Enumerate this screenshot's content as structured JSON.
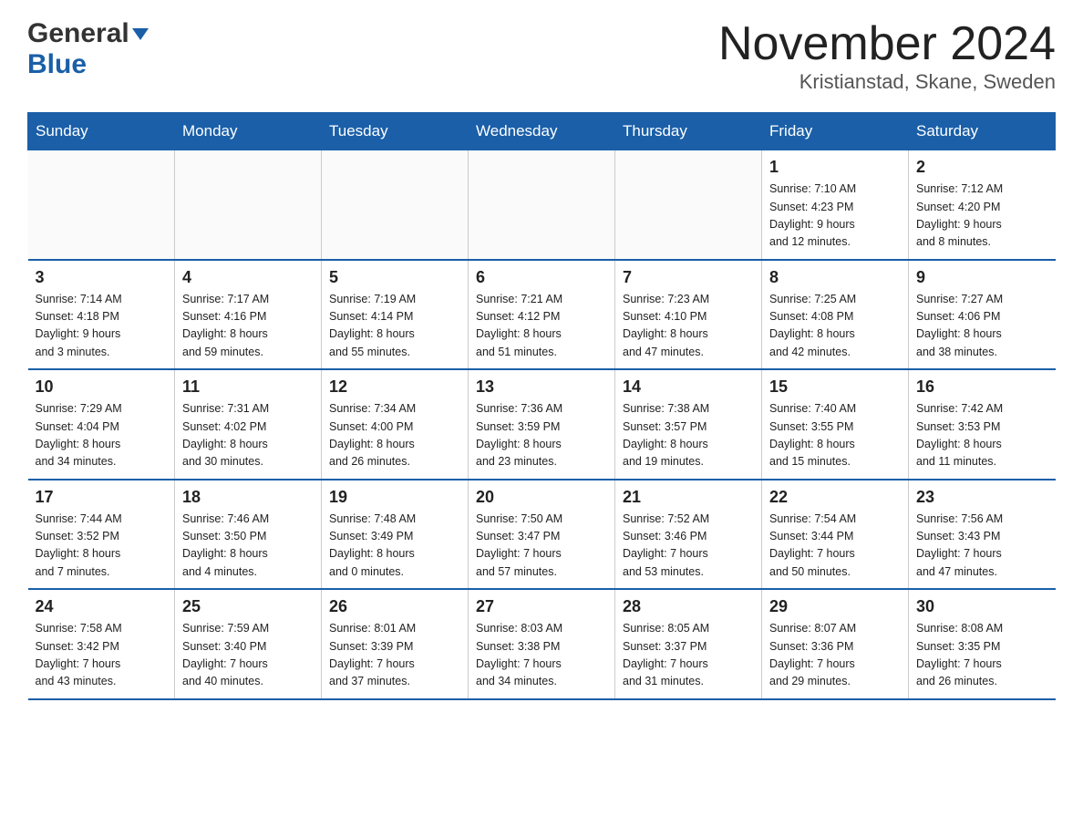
{
  "header": {
    "logo_general": "General",
    "logo_blue": "Blue",
    "month_title": "November 2024",
    "location": "Kristianstad, Skane, Sweden"
  },
  "weekdays": [
    "Sunday",
    "Monday",
    "Tuesday",
    "Wednesday",
    "Thursday",
    "Friday",
    "Saturday"
  ],
  "weeks": [
    [
      {
        "day": "",
        "info": ""
      },
      {
        "day": "",
        "info": ""
      },
      {
        "day": "",
        "info": ""
      },
      {
        "day": "",
        "info": ""
      },
      {
        "day": "",
        "info": ""
      },
      {
        "day": "1",
        "info": "Sunrise: 7:10 AM\nSunset: 4:23 PM\nDaylight: 9 hours\nand 12 minutes."
      },
      {
        "day": "2",
        "info": "Sunrise: 7:12 AM\nSunset: 4:20 PM\nDaylight: 9 hours\nand 8 minutes."
      }
    ],
    [
      {
        "day": "3",
        "info": "Sunrise: 7:14 AM\nSunset: 4:18 PM\nDaylight: 9 hours\nand 3 minutes."
      },
      {
        "day": "4",
        "info": "Sunrise: 7:17 AM\nSunset: 4:16 PM\nDaylight: 8 hours\nand 59 minutes."
      },
      {
        "day": "5",
        "info": "Sunrise: 7:19 AM\nSunset: 4:14 PM\nDaylight: 8 hours\nand 55 minutes."
      },
      {
        "day": "6",
        "info": "Sunrise: 7:21 AM\nSunset: 4:12 PM\nDaylight: 8 hours\nand 51 minutes."
      },
      {
        "day": "7",
        "info": "Sunrise: 7:23 AM\nSunset: 4:10 PM\nDaylight: 8 hours\nand 47 minutes."
      },
      {
        "day": "8",
        "info": "Sunrise: 7:25 AM\nSunset: 4:08 PM\nDaylight: 8 hours\nand 42 minutes."
      },
      {
        "day": "9",
        "info": "Sunrise: 7:27 AM\nSunset: 4:06 PM\nDaylight: 8 hours\nand 38 minutes."
      }
    ],
    [
      {
        "day": "10",
        "info": "Sunrise: 7:29 AM\nSunset: 4:04 PM\nDaylight: 8 hours\nand 34 minutes."
      },
      {
        "day": "11",
        "info": "Sunrise: 7:31 AM\nSunset: 4:02 PM\nDaylight: 8 hours\nand 30 minutes."
      },
      {
        "day": "12",
        "info": "Sunrise: 7:34 AM\nSunset: 4:00 PM\nDaylight: 8 hours\nand 26 minutes."
      },
      {
        "day": "13",
        "info": "Sunrise: 7:36 AM\nSunset: 3:59 PM\nDaylight: 8 hours\nand 23 minutes."
      },
      {
        "day": "14",
        "info": "Sunrise: 7:38 AM\nSunset: 3:57 PM\nDaylight: 8 hours\nand 19 minutes."
      },
      {
        "day": "15",
        "info": "Sunrise: 7:40 AM\nSunset: 3:55 PM\nDaylight: 8 hours\nand 15 minutes."
      },
      {
        "day": "16",
        "info": "Sunrise: 7:42 AM\nSunset: 3:53 PM\nDaylight: 8 hours\nand 11 minutes."
      }
    ],
    [
      {
        "day": "17",
        "info": "Sunrise: 7:44 AM\nSunset: 3:52 PM\nDaylight: 8 hours\nand 7 minutes."
      },
      {
        "day": "18",
        "info": "Sunrise: 7:46 AM\nSunset: 3:50 PM\nDaylight: 8 hours\nand 4 minutes."
      },
      {
        "day": "19",
        "info": "Sunrise: 7:48 AM\nSunset: 3:49 PM\nDaylight: 8 hours\nand 0 minutes."
      },
      {
        "day": "20",
        "info": "Sunrise: 7:50 AM\nSunset: 3:47 PM\nDaylight: 7 hours\nand 57 minutes."
      },
      {
        "day": "21",
        "info": "Sunrise: 7:52 AM\nSunset: 3:46 PM\nDaylight: 7 hours\nand 53 minutes."
      },
      {
        "day": "22",
        "info": "Sunrise: 7:54 AM\nSunset: 3:44 PM\nDaylight: 7 hours\nand 50 minutes."
      },
      {
        "day": "23",
        "info": "Sunrise: 7:56 AM\nSunset: 3:43 PM\nDaylight: 7 hours\nand 47 minutes."
      }
    ],
    [
      {
        "day": "24",
        "info": "Sunrise: 7:58 AM\nSunset: 3:42 PM\nDaylight: 7 hours\nand 43 minutes."
      },
      {
        "day": "25",
        "info": "Sunrise: 7:59 AM\nSunset: 3:40 PM\nDaylight: 7 hours\nand 40 minutes."
      },
      {
        "day": "26",
        "info": "Sunrise: 8:01 AM\nSunset: 3:39 PM\nDaylight: 7 hours\nand 37 minutes."
      },
      {
        "day": "27",
        "info": "Sunrise: 8:03 AM\nSunset: 3:38 PM\nDaylight: 7 hours\nand 34 minutes."
      },
      {
        "day": "28",
        "info": "Sunrise: 8:05 AM\nSunset: 3:37 PM\nDaylight: 7 hours\nand 31 minutes."
      },
      {
        "day": "29",
        "info": "Sunrise: 8:07 AM\nSunset: 3:36 PM\nDaylight: 7 hours\nand 29 minutes."
      },
      {
        "day": "30",
        "info": "Sunrise: 8:08 AM\nSunset: 3:35 PM\nDaylight: 7 hours\nand 26 minutes."
      }
    ]
  ]
}
